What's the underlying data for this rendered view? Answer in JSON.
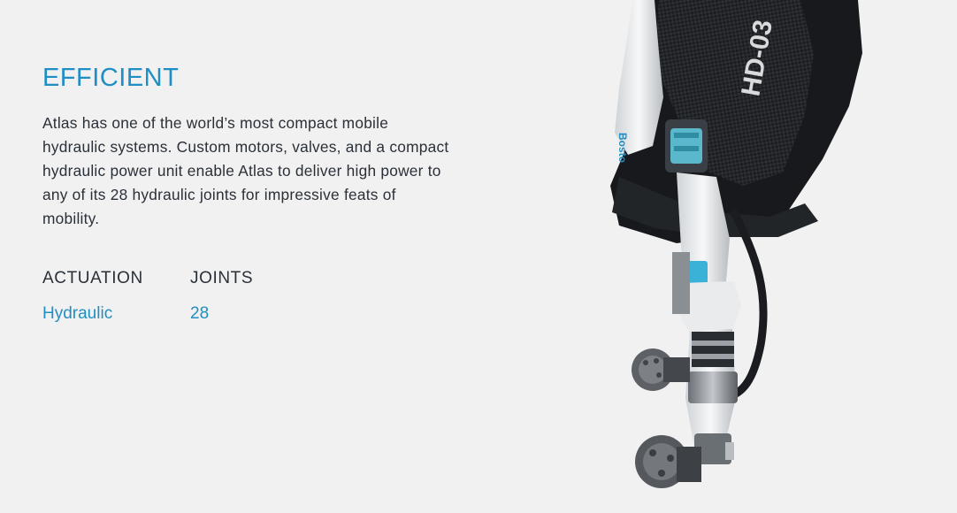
{
  "theme": {
    "accent": "#1f8ec4",
    "text": "#2a3038",
    "background": "#f1f1f1"
  },
  "section": {
    "title": "EFFICIENT",
    "description": "Atlas has one of the world’s most compact mobile hydraulic systems. Custom motors, valves, and a compact hydraulic power unit enable Atlas to deliver high power to any of its 28 hydraulic joints for impressive feats of mobility."
  },
  "specs": [
    {
      "label": "ACTUATION",
      "value": "Hydraulic"
    },
    {
      "label": "JOINTS",
      "value": "28"
    }
  ],
  "robot_image": {
    "panel_text": "HD-03",
    "logo_text": "Bosto"
  }
}
